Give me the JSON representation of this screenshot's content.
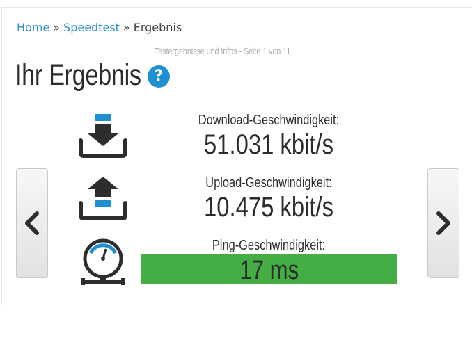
{
  "breadcrumb": {
    "home": "Home",
    "separator1": "»",
    "speedtest": "Speedtest",
    "separator2": "»",
    "current": "Ergebnis"
  },
  "subtitle": "Testergebnisse und Infos - Seite 1 von 11",
  "title": "Ihr Ergebnis",
  "help_label": "?",
  "results": {
    "download": {
      "label": "Download-Geschwindigkeit:",
      "value": "51.031 kbit/s",
      "icon": "download-icon"
    },
    "upload": {
      "label": "Upload-Geschwindigkeit:",
      "value": "10.475 kbit/s",
      "icon": "upload-icon"
    },
    "ping": {
      "label": "Ping-Geschwindigkeit:",
      "value": "17 ms",
      "icon": "speedometer-icon",
      "bar_color": "#44ad44"
    }
  },
  "colors": {
    "accent": "#2a8fc9",
    "icon_blue": "#1e90d2",
    "icon_dark": "#2d2d2d"
  },
  "nav": {
    "prev_icon": "chevron-left-icon",
    "next_icon": "chevron-right-icon"
  }
}
